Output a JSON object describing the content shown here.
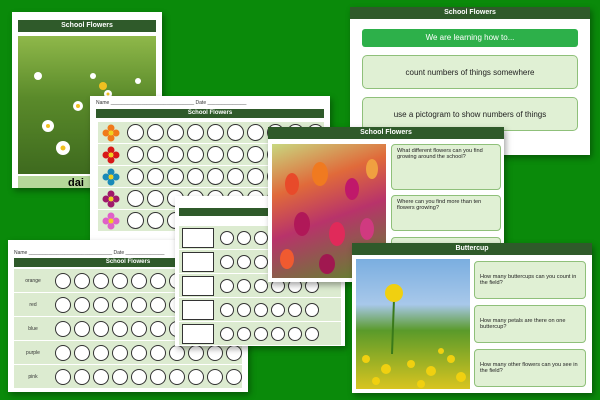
{
  "daisy_card": {
    "title": "School Flowers",
    "caption": "dai"
  },
  "pictogram_sheet": {
    "header": "Name ______________________________ Date ______________",
    "title": "School Flowers",
    "flower_colors": [
      "#f07a1a",
      "#d81818",
      "#1a8ab8",
      "#a0186a",
      "#e060c8"
    ]
  },
  "learning_goals": {
    "title": "School Flowers",
    "heading": "We are learning how to...",
    "goals": [
      "count numbers of things somewhere",
      "use a pictogram to show numbers of things"
    ]
  },
  "color_chart": {
    "header": "Name ______________________________ Date ______________",
    "title": "School Flowers",
    "rows": [
      "orange",
      "red",
      "blue",
      "purple",
      "pink"
    ]
  },
  "questions_sheet": {
    "title": "School Flowers",
    "questions": [
      "What different flowers can you find growing around the school?",
      "Where can you find more than ten flowers growing?"
    ]
  },
  "buttercup_sheet": {
    "title": "Buttercup",
    "questions": [
      "How many buttercups can you count in the field?",
      "How many petals are there on one buttercup?",
      "How many other flowers can you see in the field?"
    ]
  }
}
